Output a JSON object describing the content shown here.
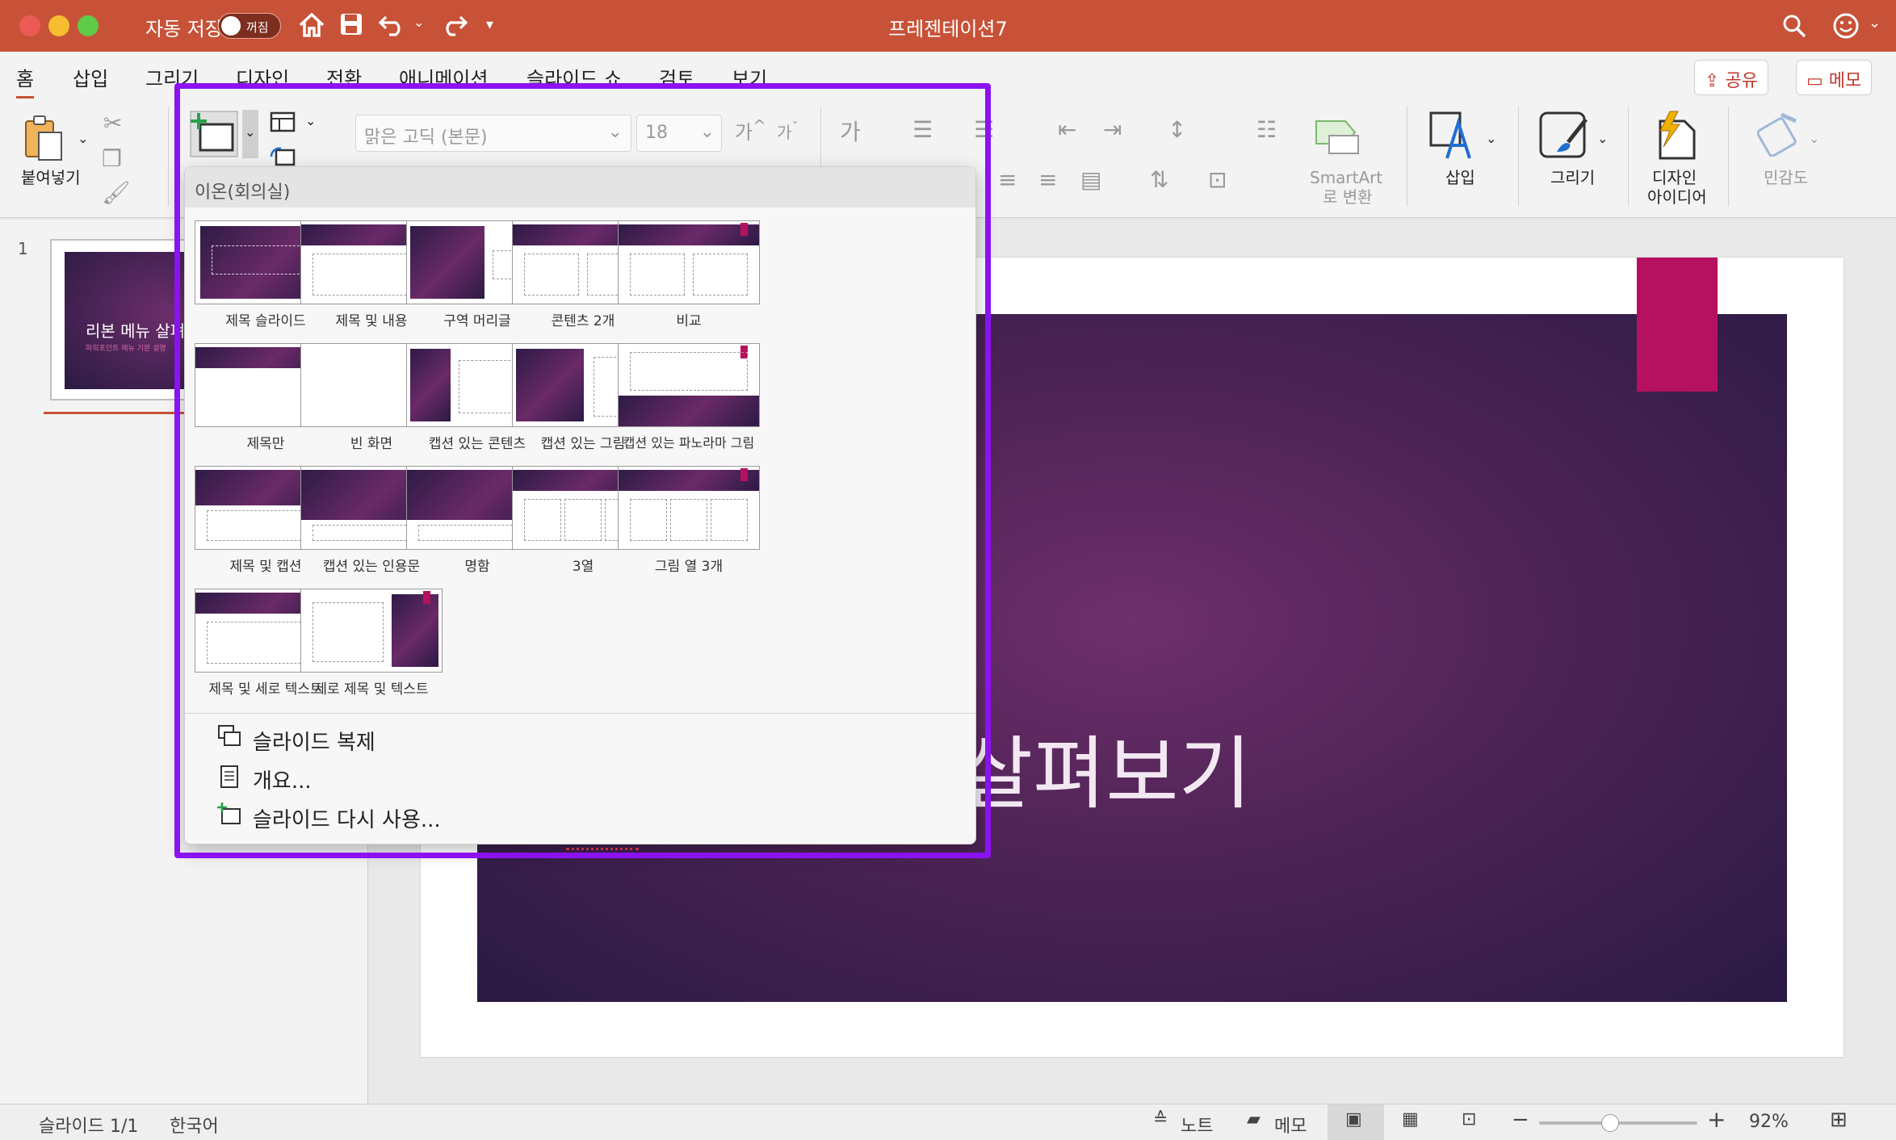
{
  "window": {
    "title": "프레젠테이션7",
    "autosave_label": "자동 저장",
    "autosave_state": "꺼짐"
  },
  "tabs": [
    "홈",
    "삽입",
    "그리기",
    "디자인",
    "전환",
    "애니메이션",
    "슬라이드 쇼",
    "검토",
    "보기"
  ],
  "header_buttons": {
    "share": "공유",
    "comments": "메모"
  },
  "ribbon": {
    "paste_label": "붙여넣기",
    "font_name": "맑은 고딕 (본문)",
    "font_size": "18",
    "font_grow": "가",
    "font_shrink": "가",
    "clear_format": "가",
    "smartart_label_1": "SmartArt",
    "smartart_label_2": "로 변환",
    "insert_label": "삽입",
    "draw_label": "그리기",
    "designer_label_1": "디자인",
    "designer_label_2": "아이디어",
    "sensitivity_label": "민감도"
  },
  "thumbnails": {
    "slide_number": "1",
    "thumb_title": "리본 메뉴 살펴",
    "thumb_subtitle": "파워포인트 메뉴 기본 설명"
  },
  "slide": {
    "title_visible": "살펴보기"
  },
  "dropdown": {
    "theme_name": "이온(회의실)",
    "layouts": [
      "제목 슬라이드",
      "제목 및 내용",
      "구역 머리글",
      "콘텐츠 2개",
      "비교",
      "제목만",
      "빈 화면",
      "캡션 있는 콘텐츠",
      "캡션 있는 그림",
      "캡션 있는 파노라마 그림",
      "제목 및 캡션",
      "캡션 있는 인용문",
      "명함",
      "3열",
      "그림 열 3개",
      "제목 및 세로 텍스트",
      "세로 제목 및 텍스트"
    ],
    "menu": {
      "duplicate": "슬라이드 복제",
      "outline": "개요...",
      "reuse": "슬라이드 다시 사용..."
    }
  },
  "status": {
    "slide_count": "슬라이드 1/1",
    "language": "한국어",
    "notes": "노트",
    "comments": "메모",
    "zoom": "92%",
    "zoom_fraction": 0.45
  },
  "colors": {
    "titlebar": "#c75237",
    "accent": "#b5115f",
    "focus_outline": "#8b12f2"
  }
}
